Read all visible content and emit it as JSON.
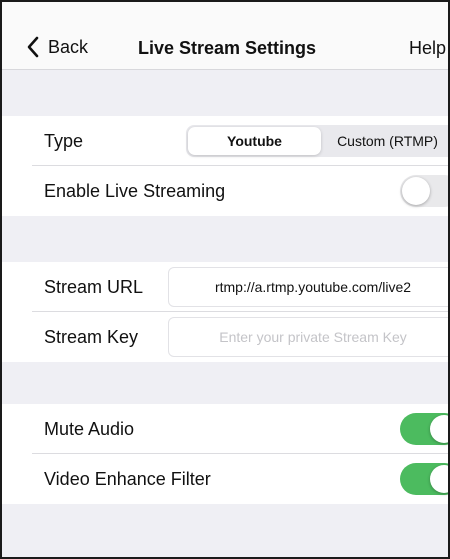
{
  "navbar": {
    "back_label": "Back",
    "title": "Live Stream Settings",
    "help_label": "Help"
  },
  "type_row": {
    "label": "Type",
    "options": [
      "Youtube",
      "Custom (RTMP)"
    ],
    "selected": "Youtube"
  },
  "enable_row": {
    "label": "Enable Live Streaming",
    "enabled": false
  },
  "stream_url_row": {
    "label": "Stream URL",
    "value": "rtmp://a.rtmp.youtube.com/live2"
  },
  "stream_key_row": {
    "label": "Stream Key",
    "value": "",
    "placeholder": "Enter your private Stream Key"
  },
  "mute_row": {
    "label": "Mute Audio",
    "enabled": true
  },
  "enhance_row": {
    "label": "Video Enhance Filter",
    "enabled": true
  },
  "colors": {
    "toggle_on": "#4cbb5f",
    "toggle_off": "#e9e9eb",
    "background": "#efeff4"
  },
  "icons": {
    "back": "chevron-left-icon"
  }
}
